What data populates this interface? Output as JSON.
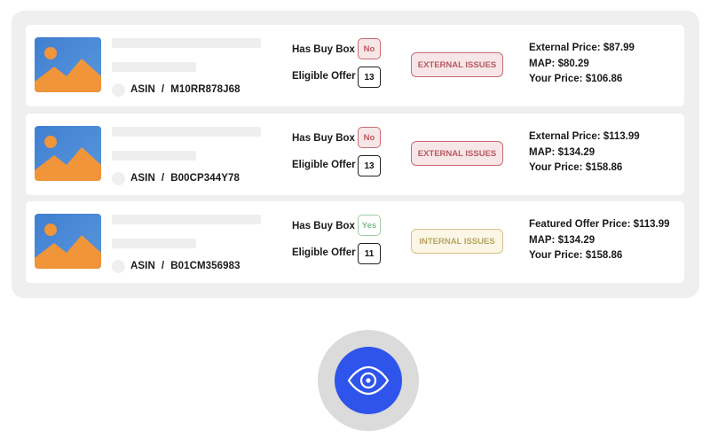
{
  "labels": {
    "has_buy_box": "Has Buy Box",
    "eligible_offer": "Eligible Offer",
    "asin": "ASIN",
    "asin_separator": "/"
  },
  "products": [
    {
      "asin": "M10RR878J68",
      "buy_box": "No",
      "eligible_offer": "13",
      "issues": "EXTERNAL ISSUES",
      "price_lines": [
        "External Price: $87.99",
        "MAP: $80.29",
        "Your Price: $106.86"
      ]
    },
    {
      "asin": "B00CP344Y78",
      "buy_box": "No",
      "eligible_offer": "13",
      "issues": "EXTERNAL ISSUES",
      "price_lines": [
        "External Price: $113.99",
        "MAP: $134.29",
        "Your Price: $158.86"
      ]
    },
    {
      "asin": "B01CM356983",
      "buy_box": "Yes",
      "eligible_offer": "11",
      "issues": "INTERNAL ISSUES",
      "price_lines": [
        "Featured Offer Price: $113.99",
        "MAP: $134.29",
        "Your Price: $158.86"
      ]
    }
  ],
  "icons": {
    "product_thumbnail": "image-placeholder-icon",
    "view_button": "eye-icon"
  },
  "colors": {
    "accent": "#2f54eb",
    "badge_no": "#c05a62",
    "badge_yes": "#82bb87",
    "external_issues": "#b85a62",
    "internal_issues": "#b8a460",
    "thumbnail_sky": "#4a86d4",
    "thumbnail_hill": "#f0953a"
  }
}
